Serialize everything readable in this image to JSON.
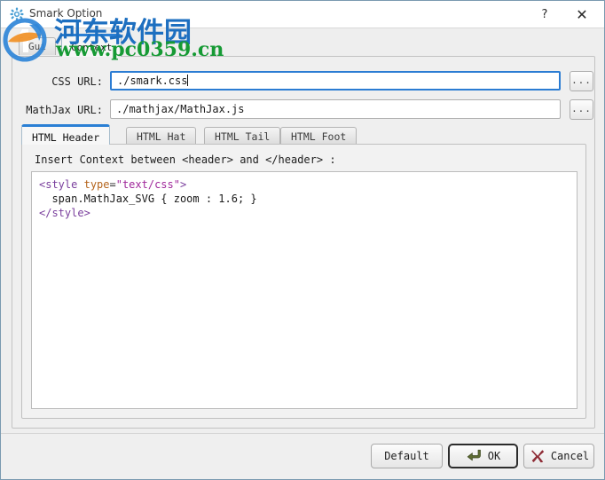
{
  "window": {
    "title": "Smark Option",
    "icon": "gear-icon",
    "help_label": "?",
    "close_label": "✕"
  },
  "outer_tabs": [
    {
      "label": "Gui",
      "active": false
    },
    {
      "label": "Context",
      "active": true
    }
  ],
  "fields": {
    "css": {
      "label": "CSS URL:",
      "value": "./smark.css",
      "browse_label": "...",
      "focused": true
    },
    "mathjax": {
      "label": "MathJax URL:",
      "value": "./mathjax/MathJax.js",
      "browse_label": "...",
      "focused": false
    }
  },
  "inner_tabs": [
    {
      "label": "HTML Header",
      "active": true
    },
    {
      "label": "HTML Hat",
      "active": false
    },
    {
      "label": "HTML Tail",
      "active": false
    },
    {
      "label": "HTML Foot",
      "active": false
    }
  ],
  "editor": {
    "hint": "Insert Context between <header> and </header> :",
    "lines": [
      {
        "tokens": [
          {
            "t": "<style",
            "c": "tag"
          },
          {
            "t": " ",
            "c": "plain"
          },
          {
            "t": "type",
            "c": "attr"
          },
          {
            "t": "=",
            "c": "punct"
          },
          {
            "t": "\"text/css\"",
            "c": "str"
          },
          {
            "t": ">",
            "c": "tag"
          }
        ]
      },
      {
        "tokens": [
          {
            "t": "  span.MathJax_SVG { zoom : 1.6; }",
            "c": "plain"
          }
        ]
      },
      {
        "tokens": [
          {
            "t": "</style>",
            "c": "tag"
          }
        ]
      }
    ]
  },
  "buttons": {
    "default": {
      "label": "Default"
    },
    "ok": {
      "label": "OK",
      "icon": "enter-arrow-icon",
      "is_default": true
    },
    "cancel": {
      "label": "Cancel",
      "icon": "red-cross-icon"
    }
  },
  "watermark": {
    "text_cn": "河东软件园",
    "text_url": "www.pc0359.cn",
    "color_cn": "#1d6fc0",
    "color_url": "#169a34"
  },
  "colors": {
    "accent": "#2a7fd4",
    "focus_border": "#2b7cd3",
    "panel": "#efefef",
    "editor_bg": "#ffffff"
  }
}
